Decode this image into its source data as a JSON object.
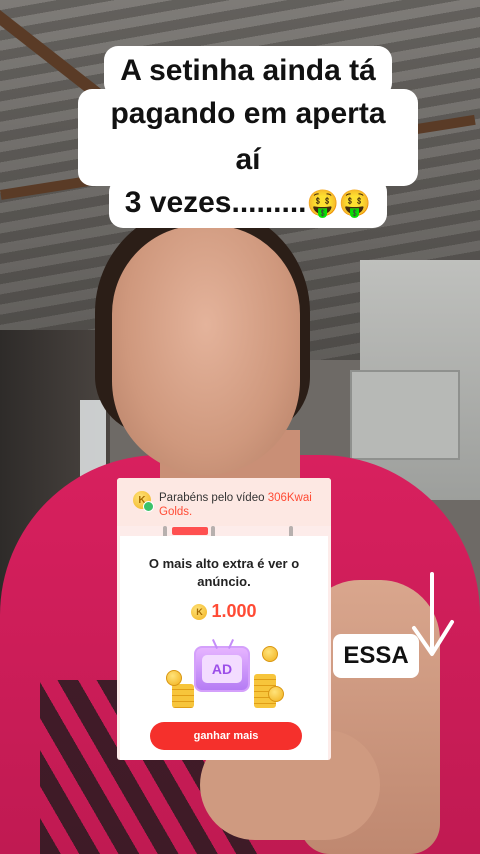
{
  "caption": {
    "line1": "A setinha ainda tá",
    "line2": "pagando em aperta aí",
    "line3": "3 vezes.........",
    "emoji": "🤑🤑"
  },
  "popup": {
    "header_text": "Parabéns pelo vídeo ",
    "header_highlight": "306Kwai Golds.",
    "badge_label": "K",
    "title": "O mais alto extra é ver o anúncio.",
    "coin_label": "K",
    "amount": "1.000",
    "ad_label": "AD",
    "button_label": "ganhar mais"
  },
  "overlay": {
    "essa_label": "ESSA"
  },
  "colors": {
    "accent": "#ff4b35",
    "button": "#f5302c",
    "shirt": "#d8205e",
    "arrow": "#ffffff"
  }
}
